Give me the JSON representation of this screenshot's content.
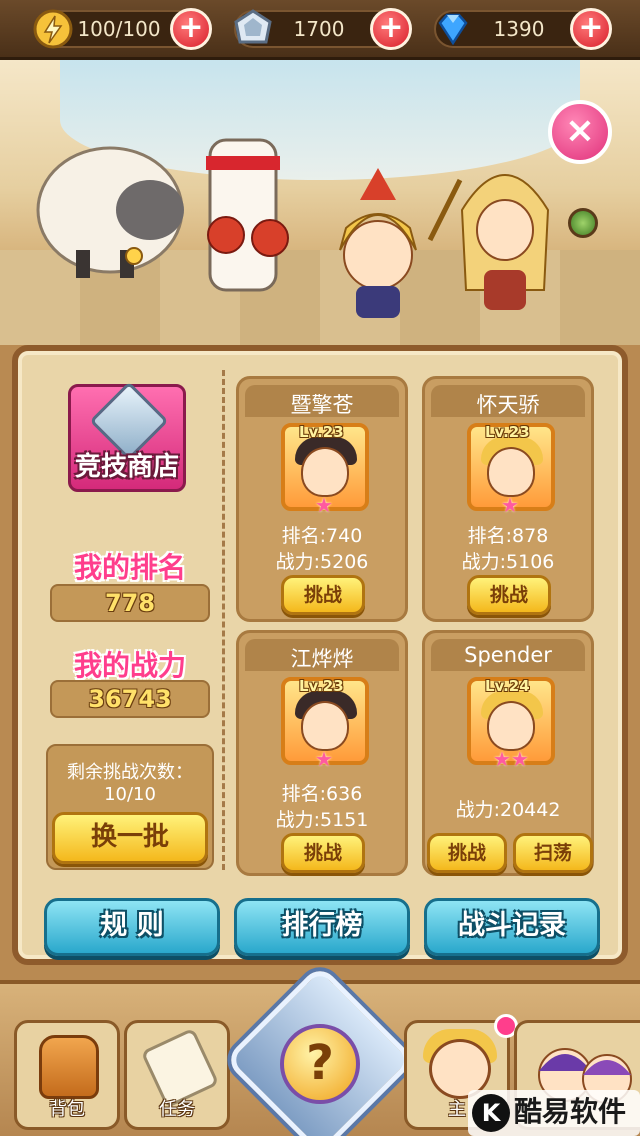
{
  "resources": {
    "energy": {
      "value": "100/100",
      "icon": "lightning-icon"
    },
    "medal": {
      "value": "1700",
      "icon": "medal-icon"
    },
    "diamond": {
      "value": "1390",
      "icon": "diamond-icon"
    },
    "plus": "+"
  },
  "close_label": "×",
  "shop": {
    "label": "竞技商店",
    "icon": "arena-shop-gem-icon"
  },
  "my_rank": {
    "title": "我的排名",
    "value": "778"
  },
  "my_power": {
    "title": "我的战力",
    "value": "36743"
  },
  "remaining": {
    "label": "剩余挑战次数：",
    "count": "10/10"
  },
  "refresh_label": "换一批",
  "opponents": [
    {
      "name": "暨擎苍",
      "level": "Lv.23",
      "rank": "排名:740",
      "power": "战力:5206",
      "stars": "★",
      "buttons": [
        "挑战"
      ]
    },
    {
      "name": "怀天骄",
      "level": "Lv.23",
      "rank": "排名:878",
      "power": "战力:5106",
      "stars": "★",
      "buttons": [
        "挑战"
      ]
    },
    {
      "name": "江烨烨",
      "level": "Lv.23",
      "rank": "排名:636",
      "power": "战力:5151",
      "stars": "★",
      "buttons": [
        "挑战"
      ]
    },
    {
      "name": "Spender",
      "level": "Lv.24",
      "rank": "",
      "power": "战力:20442",
      "stars": "★★",
      "buttons": [
        "挑战",
        "扫荡"
      ]
    }
  ],
  "actions": {
    "rules": "规 则",
    "leaderboard": "排行榜",
    "battle_log": "战斗记录"
  },
  "nav": {
    "bag": "背包",
    "tasks": "任务",
    "hero": "主",
    "center": "?"
  },
  "watermark": {
    "k": "K",
    "text": "酷易软件园"
  },
  "colors": {
    "accent_pink": "#ff3e8c",
    "panel": "#e9d5a8",
    "button_blue": "#2aa8cc",
    "button_yellow": "#f4b81c"
  }
}
